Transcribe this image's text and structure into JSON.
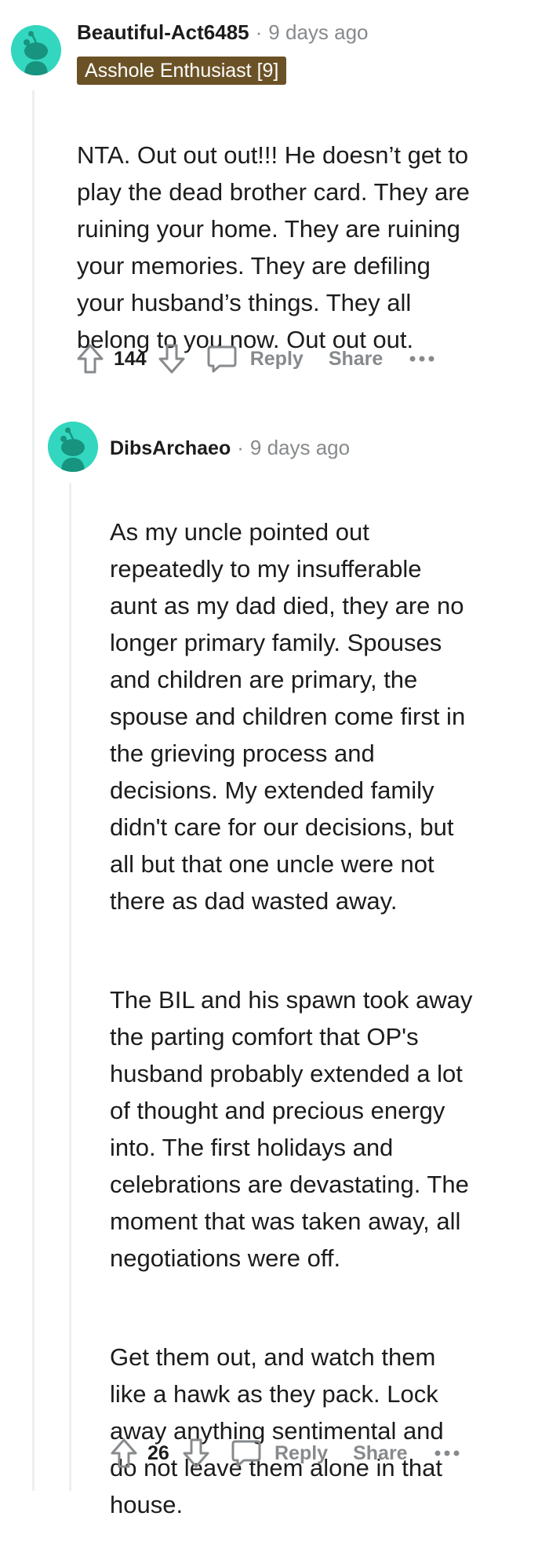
{
  "comments": [
    {
      "username": "Beautiful-Act6485",
      "separator": "·",
      "timestamp": "9 days ago",
      "flair": "Asshole Enthusiast [9]",
      "paragraphs": [
        "NTA. Out out out!!! He doesn’t get to\nplay the dead brother card. They are\nruining your home. They are ruining\nyour memories. They are defiling\nyour husband’s things. They all\nbelong to you now. Out out out."
      ],
      "votes": "144",
      "reply_label": "Reply",
      "share_label": "Share"
    },
    {
      "username": "DibsArchaeo",
      "separator": "·",
      "timestamp": "9 days ago",
      "paragraphs": [
        "As my uncle pointed out\nrepeatedly to my insufferable\naunt as my dad died, they are no\nlonger primary family. Spouses\nand children are primary, the\nspouse and children come first in\nthe grieving process and\ndecisions. My extended family\ndidn't care for our decisions, but\nall but that one uncle were not\nthere as dad wasted away.",
        "The BIL and his spawn took away\nthe parting comfort that OP's\nhusband probably extended a lot\nof thought and precious energy\ninto. The first holidays and\ncelebrations are devastating. The\nmoment that was taken away, all\nnegotiations were off.",
        "Get them out, and watch them\nlike a hawk as they pack. Lock\naway anything sentimental and\ndo not leave them alone in that\nhouse."
      ],
      "votes": "26",
      "reply_label": "Reply",
      "share_label": "Share"
    }
  ],
  "icons": {
    "avatar": "snoo-avatar-icon",
    "upvote": "upvote-arrow-icon",
    "downvote": "downvote-arrow-icon",
    "reply": "speech-bubble-icon",
    "more": "ellipsis-icon"
  },
  "colors": {
    "avatar_bg": "#33d7bf",
    "flair_bg": "#6b5226",
    "meta_gray": "#878a8c",
    "text": "#1c1c1c"
  }
}
